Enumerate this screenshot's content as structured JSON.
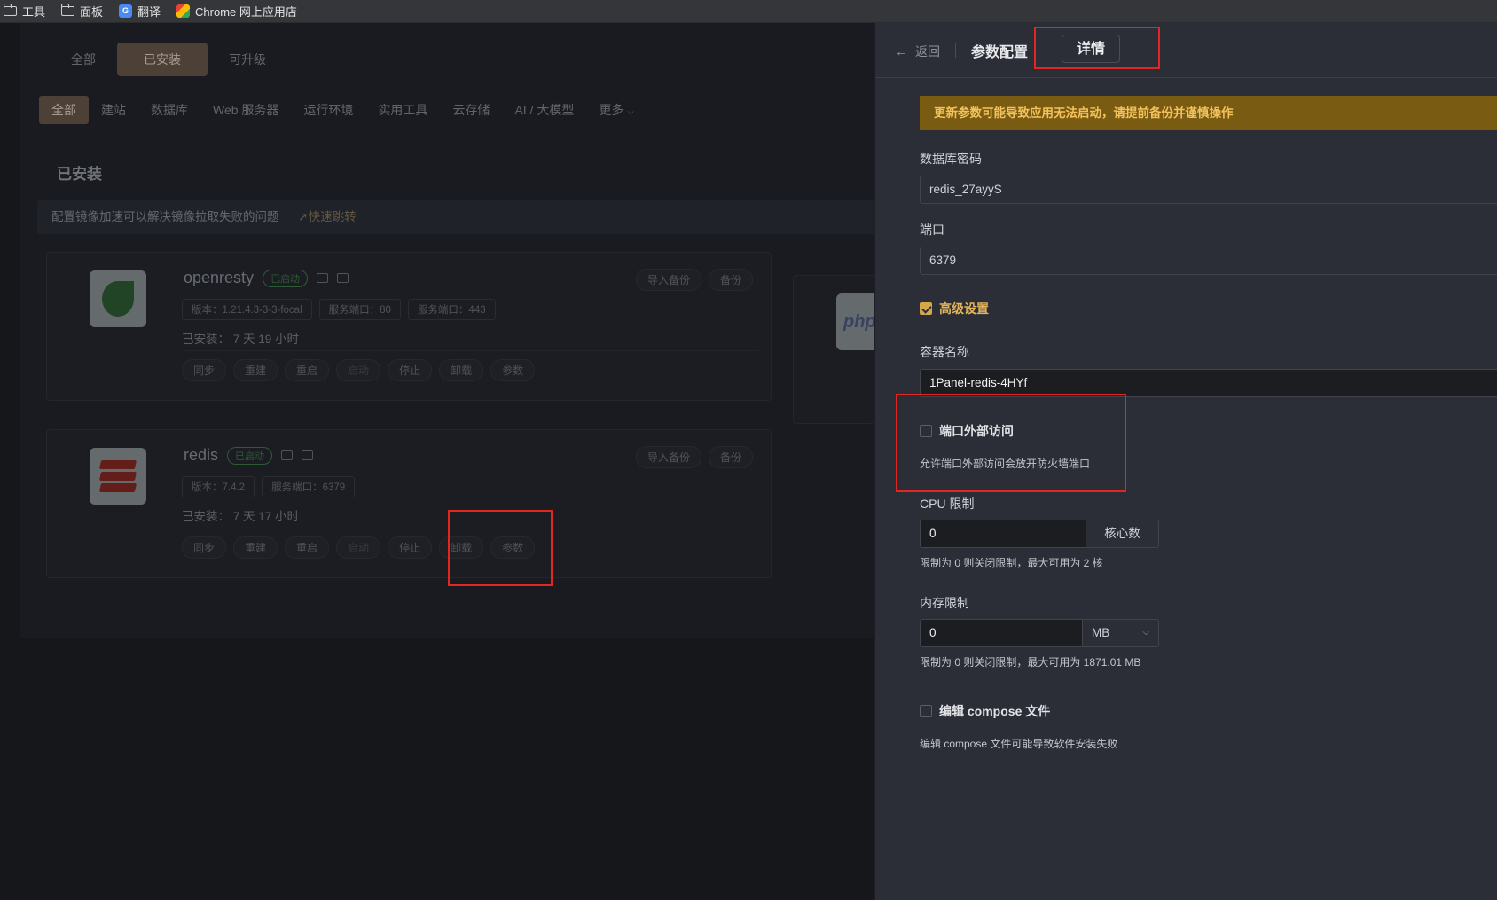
{
  "bookmarks": {
    "items": [
      {
        "label": "工具",
        "icon": "folder-icon"
      },
      {
        "label": "面板",
        "icon": "folder-icon"
      },
      {
        "label": "翻译",
        "icon": "translate-icon"
      },
      {
        "label": "Chrome 网上应用店",
        "icon": "chrome-store-icon"
      }
    ]
  },
  "app": {
    "top_tabs": [
      "全部",
      "已安装",
      "可升级"
    ],
    "categories": [
      "全部",
      "建站",
      "数据库",
      "Web 服务器",
      "运行环境",
      "实用工具",
      "云存储",
      "AI / 大模型",
      "更多"
    ],
    "section_title": "已安装",
    "notice": {
      "text": "配置镜像加速可以解决镜像拉取失败的问题",
      "jump": "快速跳转"
    },
    "cards": [
      {
        "name": "openresty",
        "status": "已启动",
        "tags": [
          "版本：1.21.4.3-3-3-focal",
          "服务端口：80",
          "服务端口：443"
        ],
        "installed": "已安装：  7 天 19 小时",
        "buttons": [
          "同步",
          "重建",
          "重启",
          "启动",
          "停止",
          "卸载",
          "参数"
        ],
        "right_buttons": [
          "导入备份",
          "备份"
        ]
      },
      {
        "name": "redis",
        "status": "已启动",
        "tags": [
          "版本：7.4.2",
          "服务端口：6379"
        ],
        "installed": "已安装：  7 天 17 小时",
        "buttons": [
          "同步",
          "重建",
          "重启",
          "启动",
          "停止",
          "卸载",
          "参数"
        ],
        "right_buttons": [
          "导入备份",
          "备份"
        ]
      }
    ],
    "peek_logo": "php"
  },
  "drawer": {
    "back": "返回",
    "title": "参数配置",
    "detail": "详情",
    "warning": "更新参数可能导致应用无法启动，请提前备份并谨慎操作",
    "db_password": {
      "label": "数据库密码",
      "value": "redis_27ayyS"
    },
    "port": {
      "label": "端口",
      "value": "6379"
    },
    "advanced": {
      "label": "高级设置",
      "checked": true
    },
    "container_name": {
      "label": "容器名称",
      "value": "1Panel-redis-4HYf"
    },
    "external_access": {
      "label": "端口外部访问",
      "checked": false,
      "hint": "允许端口外部访问会放开防火墙端口"
    },
    "cpu": {
      "label": "CPU 限制",
      "value": "0",
      "unit": "核心数",
      "hint": "限制为 0 则关闭限制，最大可用为 2 核"
    },
    "memory": {
      "label": "内存限制",
      "value": "0",
      "unit": "MB",
      "hint": "限制为 0 则关闭限制，最大可用为 1871.01 MB"
    },
    "edit_compose": {
      "label": "编辑 compose 文件",
      "checked": false,
      "hint": "编辑 compose 文件可能导致软件安装失败"
    }
  },
  "colors": {
    "accent": "#d4a74a",
    "warning_bg": "#7a5b12",
    "warning_text": "#f2c35c",
    "annotation": "#e3261f",
    "running": "#3f7e4b"
  }
}
